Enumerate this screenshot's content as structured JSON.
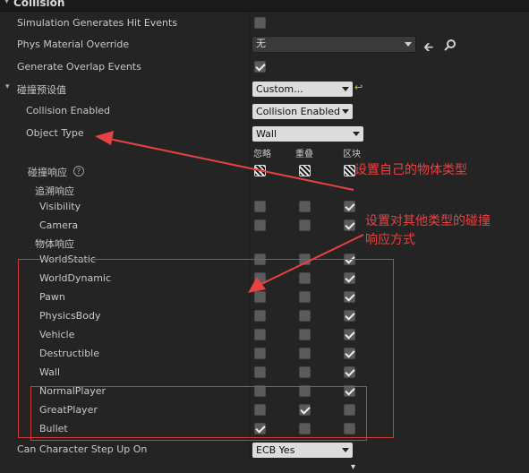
{
  "header": {
    "title": "Collision"
  },
  "rows": {
    "sim_hit": "Simulation Generates Hit Events",
    "phys_mat": "Phys Material Override",
    "phys_mat_value": "无",
    "overlap": "Generate Overlap Events",
    "preset": "碰撞预设值",
    "preset_value": "Custom...",
    "collision_enabled": "Collision Enabled",
    "collision_enabled_value": "Collision Enabled",
    "object_type": "Object Type",
    "object_type_value": "Wall",
    "response": "碰撞响应",
    "trace_response": "追溯响应",
    "object_response": "物体响应",
    "step_up": "Can Character Step Up On",
    "step_up_value": "ECB Yes"
  },
  "columns": {
    "ignore": "忽略",
    "overlap": "重叠",
    "block": "区块"
  },
  "trace_channels": [
    {
      "name": "Visibility",
      "state": "block"
    },
    {
      "name": "Camera",
      "state": "block"
    }
  ],
  "object_channels": [
    {
      "name": "WorldStatic",
      "state": "block"
    },
    {
      "name": "WorldDynamic",
      "state": "block"
    },
    {
      "name": "Pawn",
      "state": "block"
    },
    {
      "name": "PhysicsBody",
      "state": "block"
    },
    {
      "name": "Vehicle",
      "state": "block"
    },
    {
      "name": "Destructible",
      "state": "block"
    },
    {
      "name": "Wall",
      "state": "block"
    },
    {
      "name": "NormalPlayer",
      "state": "block"
    },
    {
      "name": "GreatPlayer",
      "state": "overlap"
    },
    {
      "name": "Bullet",
      "state": "ignore"
    }
  ],
  "annotations": {
    "set_own_type": "设置自己的物体类型",
    "set_response_line1": "设置对其他类型的碰撞",
    "set_response_line2": "响应方式"
  },
  "colors": {
    "annotation": "#e84141",
    "background": "#242424",
    "checkbox": "#5b5b5b"
  }
}
